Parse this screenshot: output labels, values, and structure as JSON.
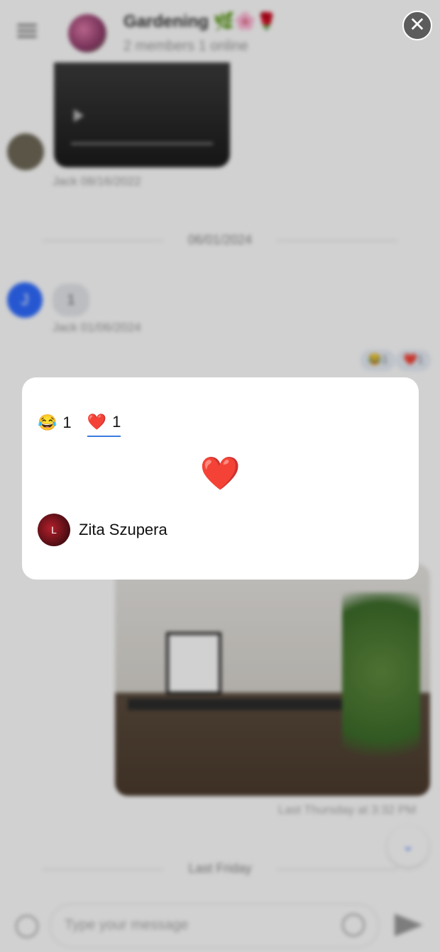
{
  "header": {
    "group_title": "Gardening 🌿🌸🌹",
    "group_subtitle": "2 members 1 online"
  },
  "messages": {
    "jack_video_meta": "Jack 08/16/2022",
    "date_divider_1": "06/01/2024",
    "bubble_text": "1",
    "jack_meta_2": "Jack 01/06/2024",
    "reaction_laugh": "😂1",
    "reaction_heart": "❤️1",
    "photo_meta": "Last Thursday at 3:32 PM",
    "date_divider_2": "Last Friday"
  },
  "composer": {
    "placeholder": "Type your message"
  },
  "modal": {
    "tabs": [
      {
        "emoji": "😂",
        "count": "1"
      },
      {
        "emoji": "❤️",
        "count": "1"
      }
    ],
    "selected_emoji": "❤️",
    "user_initial": "L",
    "user_name": "Zita Szupera"
  }
}
